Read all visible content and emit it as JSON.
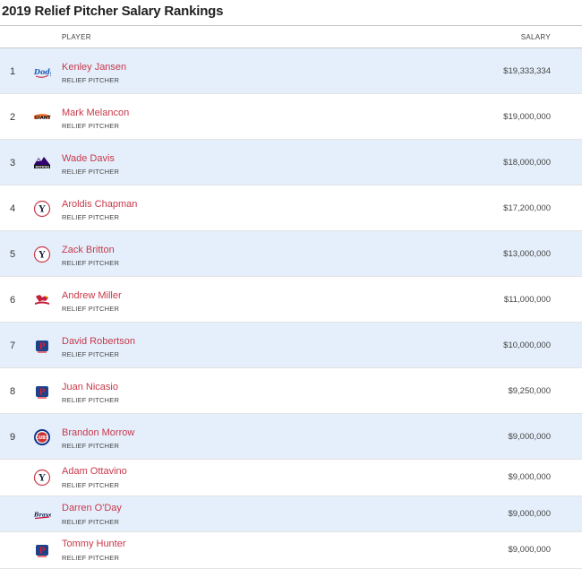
{
  "title": "2019 Relief Pitcher Salary Rankings",
  "header": {
    "player": "PLAYER",
    "salary": "SALARY"
  },
  "rows": [
    {
      "rank": "1",
      "name": "Kenley Jansen",
      "position": "RELIEF PITCHER",
      "salary": "$19,333,334",
      "team_icon": "dodgers-logo"
    },
    {
      "rank": "2",
      "name": "Mark Melancon",
      "position": "RELIEF PITCHER",
      "salary": "$19,000,000",
      "team_icon": "giants-logo"
    },
    {
      "rank": "3",
      "name": "Wade Davis",
      "position": "RELIEF PITCHER",
      "salary": "$18,000,000",
      "team_icon": "rockies-logo"
    },
    {
      "rank": "4",
      "name": "Aroldis Chapman",
      "position": "RELIEF PITCHER",
      "salary": "$17,200,000",
      "team_icon": "yankees-logo"
    },
    {
      "rank": "5",
      "name": "Zack Britton",
      "position": "RELIEF PITCHER",
      "salary": "$13,000,000",
      "team_icon": "yankees-logo"
    },
    {
      "rank": "6",
      "name": "Andrew Miller",
      "position": "RELIEF PITCHER",
      "salary": "$11,000,000",
      "team_icon": "cardinals-logo"
    },
    {
      "rank": "7",
      "name": "David Robertson",
      "position": "RELIEF PITCHER",
      "salary": "$10,000,000",
      "team_icon": "phillies-logo"
    },
    {
      "rank": "8",
      "name": "Juan Nicasio",
      "position": "RELIEF PITCHER",
      "salary": "$9,250,000",
      "team_icon": "phillies-logo"
    },
    {
      "rank": "9",
      "name": "Brandon Morrow",
      "position": "RELIEF PITCHER",
      "salary": "$9,000,000",
      "team_icon": "cubs-logo"
    },
    {
      "rank": "",
      "name": "Adam Ottavino",
      "position": "RELIEF PITCHER",
      "salary": "$9,000,000",
      "team_icon": "yankees-logo"
    },
    {
      "rank": "",
      "name": "Darren O'Day",
      "position": "RELIEF PITCHER",
      "salary": "$9,000,000",
      "team_icon": "braves-logo"
    },
    {
      "rank": "",
      "name": "Tommy Hunter",
      "position": "RELIEF PITCHER",
      "salary": "$9,000,000",
      "team_icon": "phillies-logo"
    }
  ]
}
